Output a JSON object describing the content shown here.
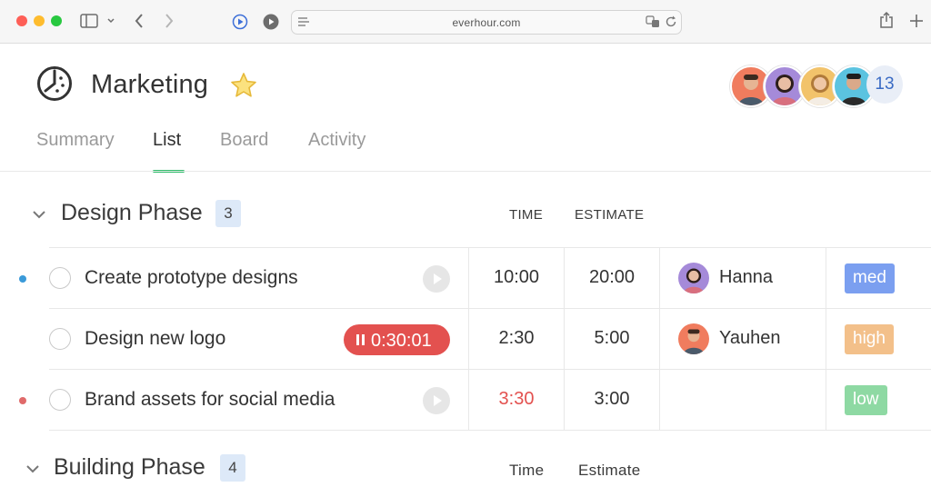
{
  "browser": {
    "url": "everhour.com"
  },
  "project": {
    "title": "Marketing",
    "icon": "project-pie-icon",
    "member_overflow": "13"
  },
  "tabs": [
    {
      "label": "Summary",
      "active": false
    },
    {
      "label": "List",
      "active": true
    },
    {
      "label": "Board",
      "active": false
    },
    {
      "label": "Activity",
      "active": false
    }
  ],
  "sections": [
    {
      "title": "Design Phase",
      "count": "3",
      "col_time": "TIME",
      "col_estimate": "ESTIMATE",
      "tasks": [
        {
          "name": "Create prototype designs",
          "time": "10:00",
          "estimate": "20:00",
          "assignee": "Hanna",
          "tag": "med",
          "tag_color": "#7b9ff0",
          "status_dot": "#3a9ad9",
          "timer": ""
        },
        {
          "name": "Design new logo",
          "time": "2:30",
          "estimate": "5:00",
          "assignee": "Yauhen",
          "tag": "high",
          "tag_color": "#f3c08a",
          "status_dot": "",
          "timer": "0:30:01"
        },
        {
          "name": "Brand assets for social media",
          "time": "3:30",
          "estimate": "3:00",
          "assignee": "",
          "tag": "low",
          "tag_color": "#8ed9a3",
          "status_dot": "#e06a6a",
          "timer": ""
        }
      ]
    },
    {
      "title": "Building Phase",
      "count": "4",
      "col_time": "Time",
      "col_estimate": "Estimate"
    }
  ],
  "colors": {
    "accent_green": "#2ebc6a",
    "timer_red": "#e3514f",
    "count_badge_bg": "#dde9f8"
  }
}
